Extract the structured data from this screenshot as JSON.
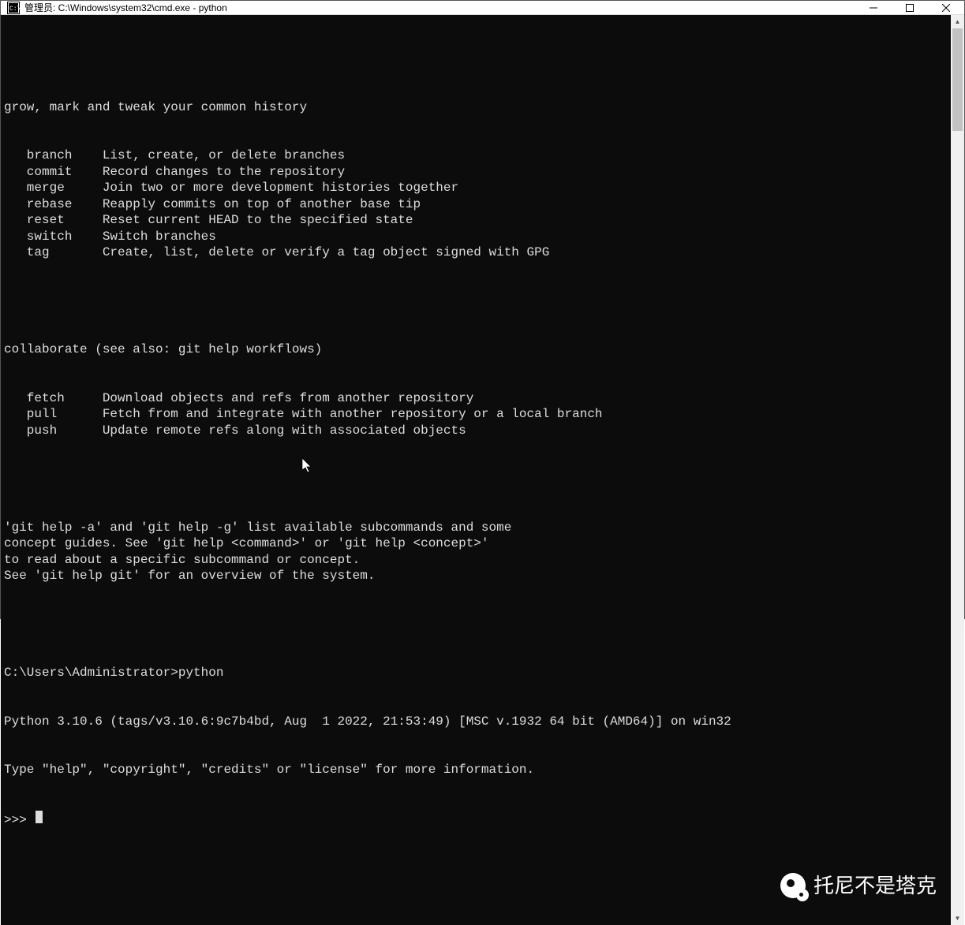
{
  "window": {
    "title": "管理员: C:\\Windows\\system32\\cmd.exe - python"
  },
  "terminal": {
    "section1_header": "grow, mark and tweak your common history",
    "section1": [
      {
        "name": "branch",
        "desc": "List, create, or delete branches"
      },
      {
        "name": "commit",
        "desc": "Record changes to the repository"
      },
      {
        "name": "merge",
        "desc": "Join two or more development histories together"
      },
      {
        "name": "rebase",
        "desc": "Reapply commits on top of another base tip"
      },
      {
        "name": "reset",
        "desc": "Reset current HEAD to the specified state"
      },
      {
        "name": "switch",
        "desc": "Switch branches"
      },
      {
        "name": "tag",
        "desc": "Create, list, delete or verify a tag object signed with GPG"
      }
    ],
    "section2_header": "collaborate (see also: git help workflows)",
    "section2": [
      {
        "name": "fetch",
        "desc": "Download objects and refs from another repository"
      },
      {
        "name": "pull",
        "desc": "Fetch from and integrate with another repository or a local branch"
      },
      {
        "name": "push",
        "desc": "Update remote refs along with associated objects"
      }
    ],
    "help_lines": [
      "'git help -a' and 'git help -g' list available subcommands and some",
      "concept guides. See 'git help <command>' or 'git help <concept>'",
      "to read about a specific subcommand or concept.",
      "See 'git help git' for an overview of the system."
    ],
    "prompt_path": "C:\\Users\\Administrator>",
    "prompt_cmd": "python",
    "python_banner1": "Python 3.10.6 (tags/v3.10.6:9c7b4bd, Aug  1 2022, 21:53:49) [MSC v.1932 64 bit (AMD64)] on win32",
    "python_banner2": "Type \"help\", \"copyright\", \"credits\" or \"license\" for more information.",
    "repl_prompt": ">>> "
  },
  "watermark": {
    "text": "托尼不是塔克"
  }
}
